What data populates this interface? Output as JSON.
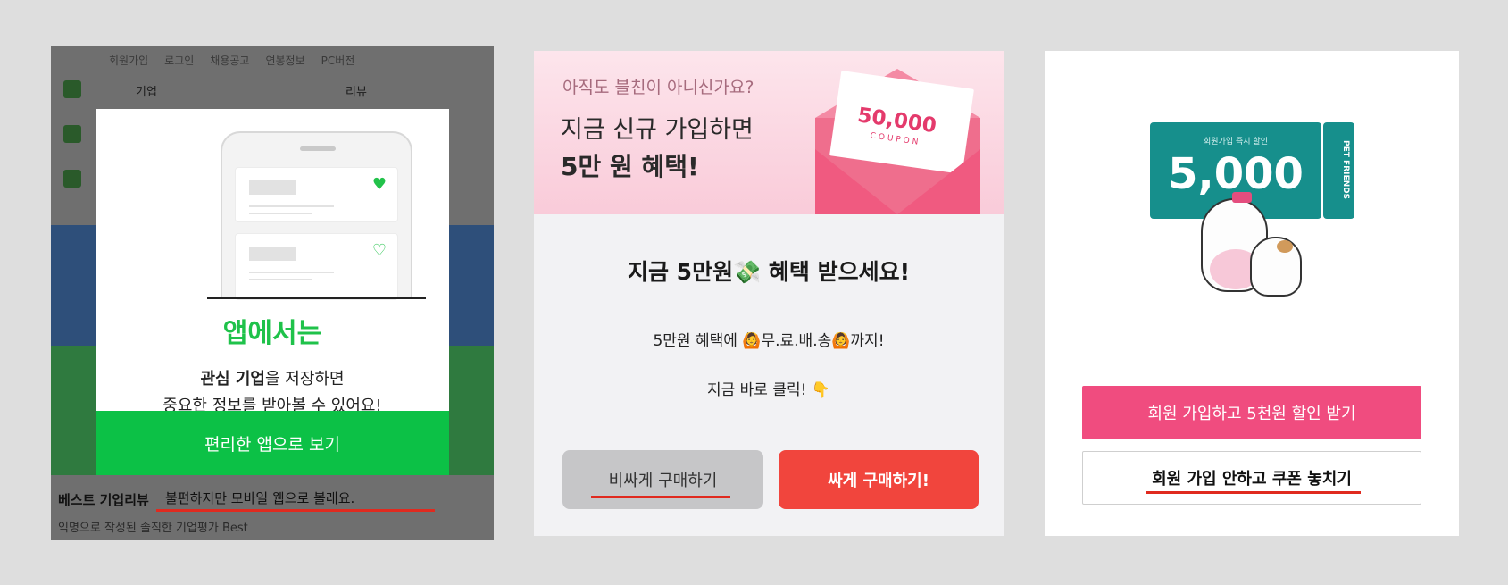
{
  "panel1": {
    "bg_nav": [
      "회원가입",
      "로그인",
      "채용공고",
      "연봉정보",
      "PC버전"
    ],
    "bg_category": "기업",
    "bg_category_right": "리뷰",
    "bg_section_title": "베스트 기업리뷰",
    "bg_section_link": "불편하지만 모바일 웹으로 볼래요.",
    "bg_section_sub": "익명으로 작성된 솔직한 기업평가 Best",
    "modal_title": "앱에서는",
    "modal_text_bold": "관심 기업",
    "modal_text_rest": "을 저장하면",
    "modal_text_line2": "중요한 정보를 받아볼 수 있어요!",
    "cta_label": "편리한 앱으로 보기"
  },
  "panel2": {
    "hero_question": "아직도 블친이 아니신가요?",
    "hero_line2": "지금 신규 가입하면",
    "hero_line3": "5만 원 혜택!",
    "coupon_value": "50,000",
    "coupon_word": "COUPON",
    "headline": "지금 5만원💸 혜택 받으세요!",
    "line1": "5만원 혜택에 🙆무.료.배.송🙆까지!",
    "line2": "지금 바로 클릭!  👇",
    "btn_expensive": "비싸게 구매하기",
    "btn_cheap": "싸게 구매하기!"
  },
  "panel3": {
    "ticket_small": "회원가입 즉시 할인",
    "ticket_amount": "5,000",
    "ticket_logo": "PET FRIENDS",
    "btn_join": "회원 가입하고 5천원 할인 받기",
    "btn_skip": "회원 가입 안하고 쿠폰 놓치기"
  },
  "colors": {
    "highlight_underline": "#e02a1f",
    "panel1_green": "#0cc146",
    "panel2_red": "#f1453d",
    "panel3_pink": "#f04c7f",
    "panel3_teal": "#168f8c"
  }
}
